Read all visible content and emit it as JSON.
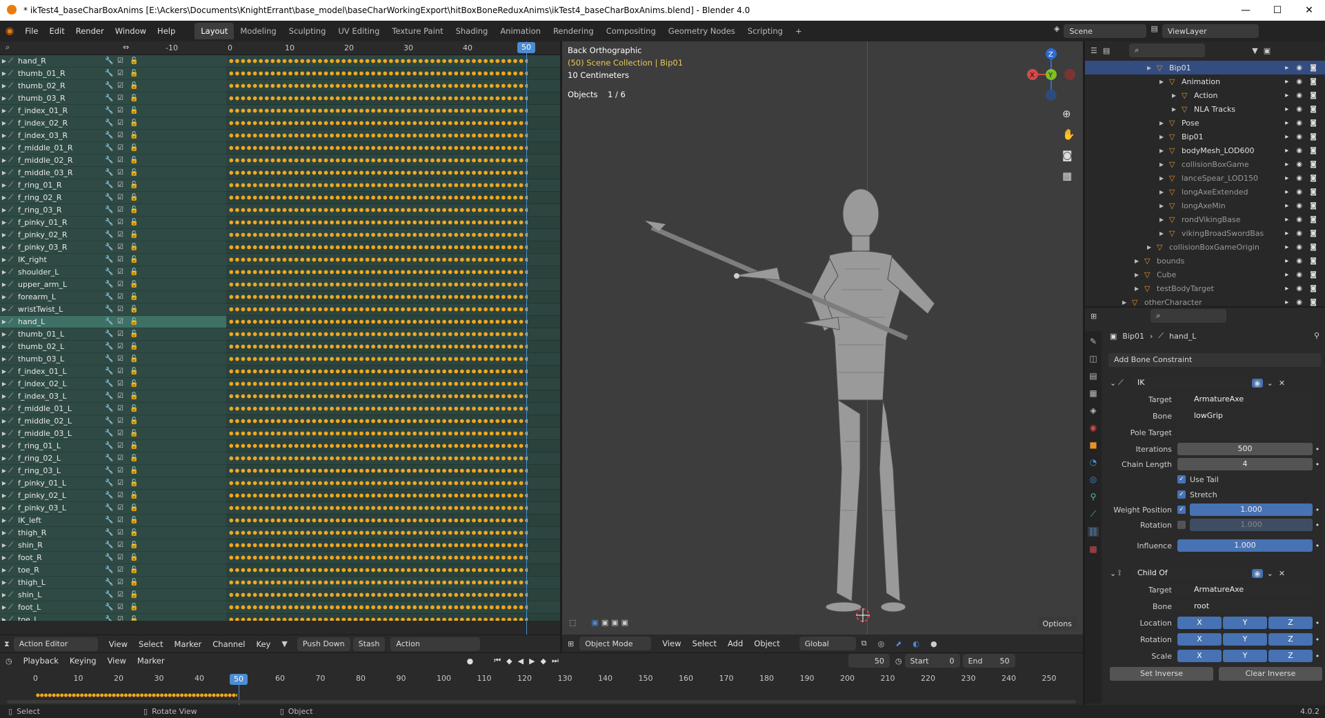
{
  "window": {
    "title": "* ikTest4_baseCharBoxAnims [E:\\Ackers\\Documents\\KnightErrant\\base_model\\baseCharWorkingExport\\hitBoxBoneReduxAnims\\ikTest4_baseCharBoxAnims.blend] - Blender 4.0",
    "min": "—",
    "max": "☐",
    "close": "✕"
  },
  "menu": [
    "File",
    "Edit",
    "Render",
    "Window",
    "Help"
  ],
  "workspaces": [
    "Layout",
    "Modeling",
    "Sculpting",
    "UV Editing",
    "Texture Paint",
    "Shading",
    "Animation",
    "Rendering",
    "Compositing",
    "Geometry Nodes",
    "Scripting",
    "+"
  ],
  "scene": "Scene",
  "viewlayer": "ViewLayer",
  "dopesheet": {
    "ticks": [
      "-10",
      "0",
      "10",
      "20",
      "30",
      "40",
      "50"
    ],
    "current_frame": "50",
    "channels": [
      "hand_R",
      "thumb_01_R",
      "thumb_02_R",
      "thumb_03_R",
      "f_index_01_R",
      "f_index_02_R",
      "f_index_03_R",
      "f_middle_01_R",
      "f_middle_02_R",
      "f_middle_03_R",
      "f_ring_01_R",
      "f_ring_02_R",
      "f_ring_03_R",
      "f_pinky_01_R",
      "f_pinky_02_R",
      "f_pinky_03_R",
      "IK_right",
      "shoulder_L",
      "upper_arm_L",
      "forearm_L",
      "wristTwist_L",
      "hand_L",
      "thumb_01_L",
      "thumb_02_L",
      "thumb_03_L",
      "f_index_01_L",
      "f_index_02_L",
      "f_index_03_L",
      "f_middle_01_L",
      "f_middle_02_L",
      "f_middle_03_L",
      "f_ring_01_L",
      "f_ring_02_L",
      "f_ring_03_L",
      "f_pinky_01_L",
      "f_pinky_02_L",
      "f_pinky_03_L",
      "IK_left",
      "thigh_R",
      "shin_R",
      "foot_R",
      "toe_R",
      "thigh_L",
      "shin_L",
      "foot_L",
      "toe_L"
    ],
    "selected_channel": "hand_L",
    "footer": {
      "editor": "Action Editor",
      "view": "View",
      "select": "Select",
      "marker": "Marker",
      "channel": "Channel",
      "key": "Key",
      "push_down": "Push Down",
      "stash": "Stash",
      "action": "Action"
    }
  },
  "viewport": {
    "view_name": "Back Orthographic",
    "collection": "(50) Scene Collection | Bip01",
    "scale": "10 Centimeters",
    "objects_label": "Objects",
    "objects_value": "1 / 6",
    "gizmo": {
      "z": "Z",
      "y": "Y",
      "x": "X"
    },
    "options": "Options",
    "footer": {
      "mode": "Object Mode",
      "view": "View",
      "select": "Select",
      "add": "Add",
      "object": "Object",
      "orientation": "Global"
    }
  },
  "timeline": {
    "menus": [
      "Playback",
      "Keying",
      "View",
      "Marker"
    ],
    "current": "50",
    "start_label": "Start",
    "start": "0",
    "end_label": "End",
    "end": "50",
    "ruler": [
      "0",
      "10",
      "20",
      "30",
      "40",
      "50",
      "60",
      "70",
      "80",
      "90",
      "100",
      "110",
      "120",
      "130",
      "140",
      "150",
      "160",
      "170",
      "180",
      "190",
      "200",
      "210",
      "220",
      "230",
      "240",
      "250"
    ]
  },
  "status": {
    "select": "Select",
    "rotate": "Rotate View",
    "object": "Object",
    "version": "4.0.2"
  },
  "outliner": {
    "rows": [
      {
        "label": "Bip01",
        "indent": 5,
        "sel": true,
        "dim": false
      },
      {
        "label": "Animation",
        "indent": 6,
        "sel": false,
        "dim": false
      },
      {
        "label": "Action",
        "indent": 7,
        "sel": false,
        "dim": false
      },
      {
        "label": "NLA Tracks",
        "indent": 7,
        "sel": false,
        "dim": false
      },
      {
        "label": "Pose",
        "indent": 6,
        "sel": false,
        "dim": false
      },
      {
        "label": "Bip01",
        "indent": 6,
        "sel": false,
        "dim": false
      },
      {
        "label": "bodyMesh_LOD600",
        "indent": 6,
        "sel": false,
        "dim": false
      },
      {
        "label": "collisionBoxGame",
        "indent": 6,
        "sel": false,
        "dim": true
      },
      {
        "label": "lanceSpear_LOD150",
        "indent": 6,
        "sel": false,
        "dim": true
      },
      {
        "label": "longAxeExtended",
        "indent": 6,
        "sel": false,
        "dim": true
      },
      {
        "label": "longAxeMin",
        "indent": 6,
        "sel": false,
        "dim": true
      },
      {
        "label": "rondVikingBase",
        "indent": 6,
        "sel": false,
        "dim": true
      },
      {
        "label": "vikingBroadSwordBas",
        "indent": 6,
        "sel": false,
        "dim": true
      },
      {
        "label": "collisionBoxGameOrigin",
        "indent": 5,
        "sel": false,
        "dim": true
      },
      {
        "label": "bounds",
        "indent": 4,
        "sel": false,
        "dim": true
      },
      {
        "label": "Cube",
        "indent": 4,
        "sel": false,
        "dim": true
      },
      {
        "label": "testBodyTarget",
        "indent": 4,
        "sel": false,
        "dim": true
      },
      {
        "label": "otherCharacter",
        "indent": 3,
        "sel": false,
        "dim": true
      }
    ]
  },
  "properties": {
    "breadcrumb_obj": "Bip01",
    "breadcrumb_bone": "hand_L",
    "add_constraint": "Add Bone Constraint",
    "ik": {
      "name": "IK",
      "target_label": "Target",
      "target": "ArmatureAxe",
      "bone_label": "Bone",
      "bone": "lowGrip",
      "pole_label": "Pole Target",
      "iter_label": "Iterations",
      "iterations": "500",
      "chain_label": "Chain Length",
      "chain": "4",
      "use_tail": "Use Tail",
      "stretch": "Stretch",
      "weight_label": "Weight Position",
      "weight": "1.000",
      "rot_label": "Rotation",
      "rot": "1.000",
      "influence_label": "Influence",
      "influence": "1.000"
    },
    "childof": {
      "name": "Child Of",
      "target_label": "Target",
      "target": "ArmatureAxe",
      "bone_label": "Bone",
      "bone": "root",
      "loc_label": "Location",
      "rot_label": "Rotation",
      "scale_label": "Scale",
      "x": "X",
      "y": "Y",
      "z": "Z",
      "set_inverse": "Set Inverse",
      "clear_inverse": "Clear Inverse"
    }
  }
}
